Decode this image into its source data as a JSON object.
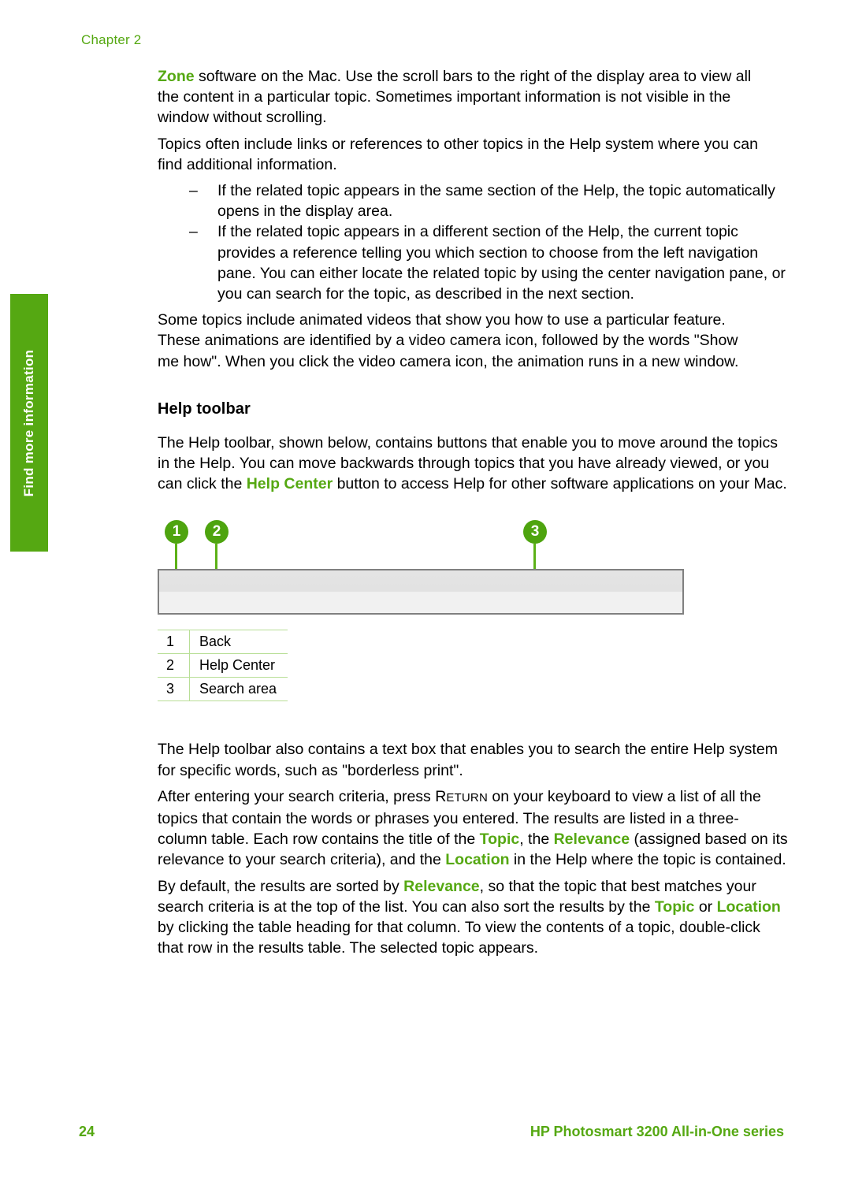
{
  "page": {
    "chapter_label": "Chapter 2",
    "page_number": "24",
    "product_name": "HP Photosmart 3200 All-in-One series",
    "accent_green": "#55a812",
    "callout_green": "#4ea40f",
    "legend_border_green": "#b8de96"
  },
  "side_tab": {
    "label": "Find more information"
  },
  "body": {
    "para1_lead_green": "Zone",
    "para1_rest": " software on the Mac. Use the scroll bars to the right of the display area to view all the content in a particular topic. Sometimes important information is not visible in the window without scrolling.",
    "para2": "Topics often include links or references to other topics in the Help system where you can find additional information.",
    "dash_items": [
      "If the related topic appears in the same section of the Help, the topic automatically opens in the display area.",
      "If the related topic appears in a different section of the Help, the current topic provides a reference telling you which section to choose from the left navigation pane. You can either locate the related topic by using the center navigation pane, or you can search for the topic, as described in the next section."
    ],
    "dash_marker": "–",
    "para3": "Some topics include animated videos that show you how to use a particular feature. These animations are identified by a video camera icon, followed by the words \"Show me how\". When you click the video camera icon, the animation runs in a new window."
  },
  "help_toolbar_section": {
    "heading": "Help toolbar",
    "intro_part1": "The Help toolbar, shown below, contains buttons that enable you to move around the topics in the Help. You can move backwards through topics that you have already viewed, or you can click the ",
    "intro_green": "Help Center",
    "intro_part2": " button to access Help for other software applications on your Mac."
  },
  "figure": {
    "callouts": [
      {
        "number": "1",
        "label": "Back"
      },
      {
        "number": "2",
        "label": "Help Center"
      },
      {
        "number": "3",
        "label": "Search area"
      }
    ],
    "legend_rows": [
      {
        "num": "1",
        "label": "Back"
      },
      {
        "num": "2",
        "label": "Help Center"
      },
      {
        "num": "3",
        "label": "Search area"
      }
    ]
  },
  "search_section": {
    "para1": "The Help toolbar also contains a text box that enables you to search the entire Help system for specific words, such as \"borderless print\".",
    "para2_a": "After entering your search criteria, press ",
    "para2_key_first": "R",
    "para2_key_rest": "ETURN",
    "para2_b": " on your keyboard to view a list of all the topics that contain the words or phrases you entered. The results are listed in a three-column table. Each row contains the title of the ",
    "para2_topic": "Topic",
    "para2_c": ", the ",
    "para2_relevance": "Relevance",
    "para2_d": " (assigned based on its relevance to your search criteria), and the ",
    "para2_location": "Location",
    "para2_e": " in the Help where the topic is contained.",
    "para3_a": "By default, the results are sorted by ",
    "para3_relevance": "Relevance",
    "para3_b": ", so that the topic that best matches your search criteria is at the top of the list. You can also sort the results by the ",
    "para3_topic": "Topic",
    "para3_c": " or ",
    "para3_location": "Location",
    "para3_d": " by clicking the table heading for that column. To view the contents of a topic, double-click that row in the results table. The selected topic appears."
  }
}
